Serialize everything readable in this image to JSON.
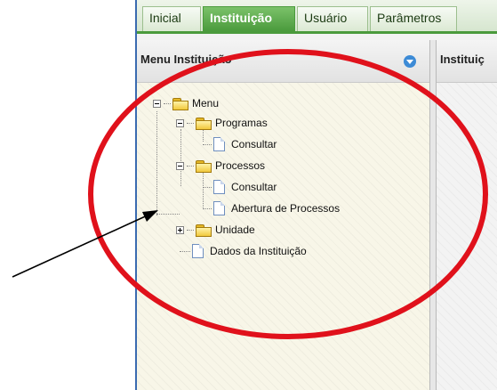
{
  "tabs": [
    {
      "label": "Inicial",
      "active": false
    },
    {
      "label": "Instituição",
      "active": true
    },
    {
      "label": "Usuário",
      "active": false
    },
    {
      "label": "Parâmetros",
      "active": false
    }
  ],
  "left_panel": {
    "title": "Menu Instituição",
    "tree": {
      "root": "Menu",
      "programas": "Programas",
      "programas_consultar": "Consultar",
      "processos": "Processos",
      "processos_consultar": "Consultar",
      "processos_abertura": "Abertura de Processos",
      "unidade": "Unidade",
      "dados": "Dados da Instituição"
    }
  },
  "right_panel": {
    "title": "Instituiç"
  },
  "colors": {
    "accent_green": "#4a9a3c",
    "annotation_red": "#e0111b",
    "panel_bg": "#f8f6e8",
    "collapse_icon": "#3d8bd6"
  },
  "icons": [
    "folder-icon",
    "file-icon",
    "tree-toggle-minus",
    "tree-toggle-plus",
    "collapse-icon"
  ]
}
